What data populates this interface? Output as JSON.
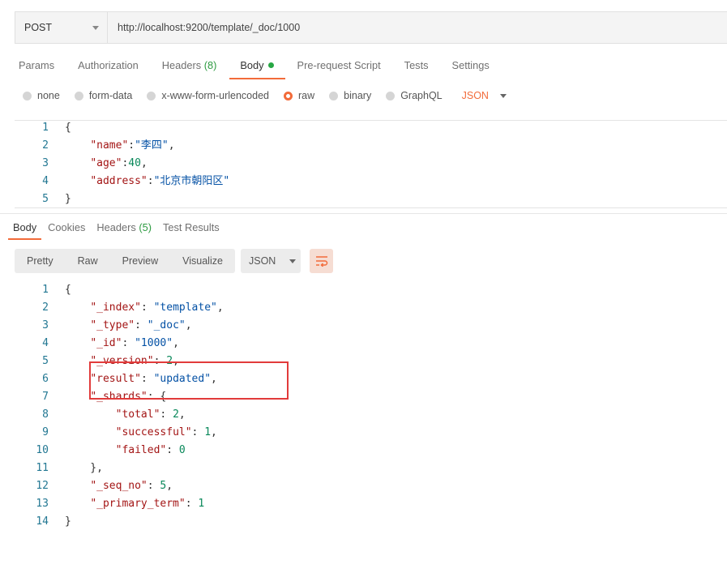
{
  "request": {
    "method": "POST",
    "url": "http://localhost:9200/template/_doc/1000"
  },
  "request_tabs": [
    {
      "label": "Params"
    },
    {
      "label": "Authorization"
    },
    {
      "label": "Headers",
      "count": "(8)"
    },
    {
      "label": "Body",
      "active": true
    },
    {
      "label": "Pre-request Script"
    },
    {
      "label": "Tests"
    },
    {
      "label": "Settings"
    }
  ],
  "body_modes": [
    "none",
    "form-data",
    "x-www-form-urlencoded",
    "raw",
    "binary",
    "GraphQL"
  ],
  "body_selected_mode": "raw",
  "body_format": "JSON",
  "request_body_lines": [
    {
      "n": "1",
      "t": "{"
    },
    {
      "n": "2",
      "t": "    \"name\":\"李四\","
    },
    {
      "n": "3",
      "t": "    \"age\":40,"
    },
    {
      "n": "4",
      "t": "    \"address\":\"北京市朝阳区\""
    },
    {
      "n": "5",
      "t": "}"
    }
  ],
  "response_tabs": [
    {
      "label": "Body",
      "active": true
    },
    {
      "label": "Cookies"
    },
    {
      "label": "Headers",
      "count": "(5)"
    },
    {
      "label": "Test Results"
    }
  ],
  "response_view_modes": [
    "Pretty",
    "Raw",
    "Preview",
    "Visualize"
  ],
  "response_format": "JSON",
  "response_body_lines": [
    {
      "n": "1",
      "t": "{"
    },
    {
      "n": "2",
      "t": "    \"_index\": \"template\","
    },
    {
      "n": "3",
      "t": "    \"_type\": \"_doc\","
    },
    {
      "n": "4",
      "t": "    \"_id\": \"1000\","
    },
    {
      "n": "5",
      "t": "    \"_version\": 2,"
    },
    {
      "n": "6",
      "t": "    \"result\": \"updated\","
    },
    {
      "n": "7",
      "t": "    \"_shards\": {"
    },
    {
      "n": "8",
      "t": "        \"total\": 2,"
    },
    {
      "n": "9",
      "t": "        \"successful\": 1,"
    },
    {
      "n": "10",
      "t": "        \"failed\": 0"
    },
    {
      "n": "11",
      "t": "    },"
    },
    {
      "n": "12",
      "t": "    \"_seq_no\": 5,"
    },
    {
      "n": "13",
      "t": "    \"_primary_term\": 1"
    },
    {
      "n": "14",
      "t": "}"
    }
  ],
  "colors": {
    "accent": "#f26b3a",
    "active_dot": "#27a744",
    "highlight_box": "#e23b3b"
  }
}
